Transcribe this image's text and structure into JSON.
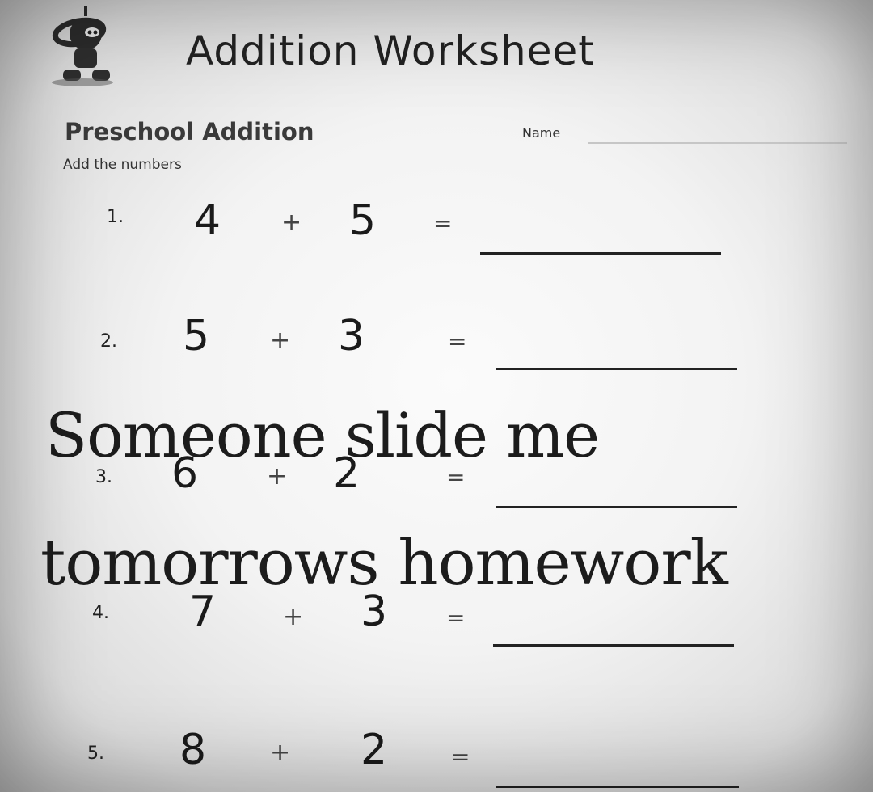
{
  "worksheet": {
    "title": "Addition Worksheet",
    "subtitle": "Preschool Addition",
    "instruction": "Add the numbers",
    "name_label": "Name",
    "logo_icon": "cartoon-mascot-icon",
    "problems": [
      {
        "number": "1.",
        "a": "4",
        "op": "+",
        "b": "5",
        "eq": "="
      },
      {
        "number": "2.",
        "a": "5",
        "op": "+",
        "b": "3",
        "eq": "="
      },
      {
        "number": "3.",
        "a": "6",
        "op": "+",
        "b": "2",
        "eq": "="
      },
      {
        "number": "4.",
        "a": "7",
        "op": "+",
        "b": "3",
        "eq": "="
      },
      {
        "number": "5.",
        "a": "8",
        "op": "+",
        "b": "2",
        "eq": "="
      }
    ]
  },
  "caption": {
    "line1": "Someone slide me",
    "line2": "tomorrows homework"
  }
}
